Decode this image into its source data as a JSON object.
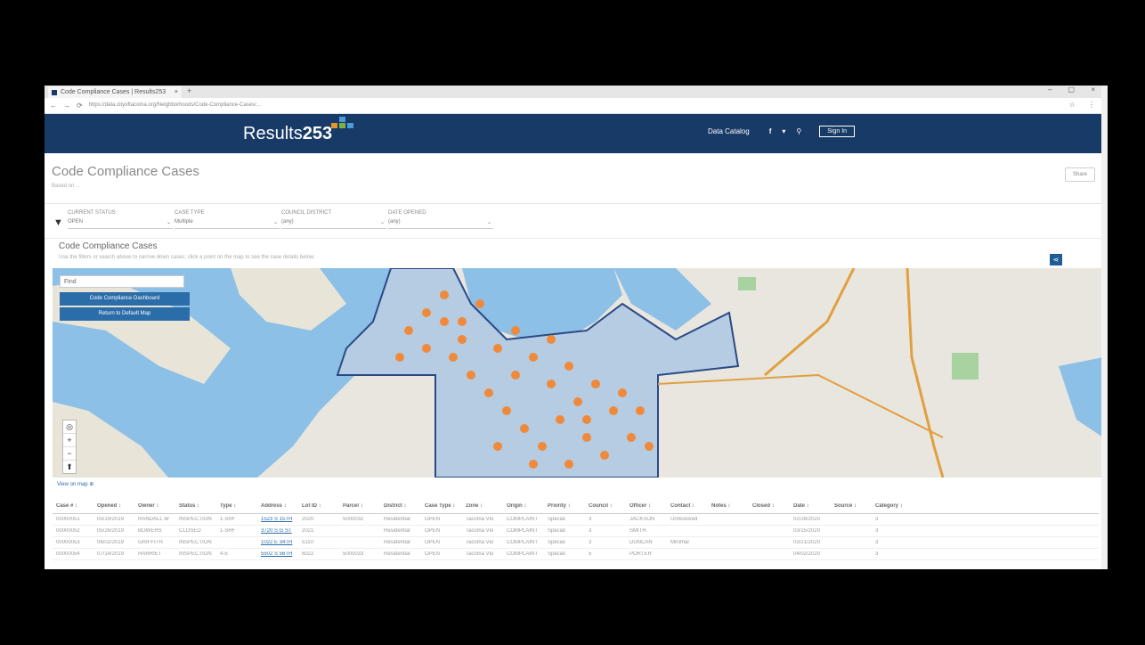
{
  "browser": {
    "tab_title": "Code Compliance Cases | Results253",
    "tab_close": "×",
    "new_tab": "+",
    "window_controls": "– ▢ ×",
    "nav_back": "←",
    "nav_forward": "→",
    "nav_reload": "⟳",
    "url": "https://data.cityoftacoma.org/Neighborhoods/Code-Compliance-Cases/...",
    "toolbar_right": "☆ ⋮"
  },
  "navbar": {
    "logo_text": "Results",
    "logo_number": "253",
    "data_catalog": "Data Catalog",
    "facebook_icon": "f",
    "twitter_icon": "▾",
    "search_icon": "⚲",
    "sign_in": "Sign In"
  },
  "page": {
    "title": "Code Compliance Cases",
    "subtitle": "Based on ...",
    "share_label": "Share"
  },
  "filters": [
    {
      "label": "CURRENT STATUS",
      "value": "OPEN"
    },
    {
      "label": "CASE TYPE",
      "value": "Multiple"
    },
    {
      "label": "COUNCIL DISTRICT",
      "value": "(any)"
    },
    {
      "label": "DATE OPENED",
      "value": "(any)"
    }
  ],
  "section": {
    "title": "Code Compliance Cases",
    "description": "Use the filters or search above to narrow down cases; click a point on the map to see the case details below."
  },
  "map": {
    "search_placeholder": "Find",
    "btn_report": "Code Compliance Dashboard",
    "btn_return": "Return to Default Map",
    "link_text": "View on map ⊕",
    "colors": {
      "water": "#8cc0e6",
      "city_fill": "#b5cce3",
      "boundary": "#2a4a86",
      "points": "#f08a3a"
    }
  },
  "table": {
    "headers": [
      "Case #",
      "Opened",
      "Owner",
      "Status",
      "Type",
      "Address",
      "Lot ID",
      "Parcel",
      "District",
      "Case Type",
      "Zone",
      "Origin",
      "Priority",
      "Council",
      "Officer",
      "Contact",
      "Notes",
      "Closed",
      "Date",
      "Source",
      "Category"
    ],
    "rows": [
      [
        "00000051",
        "05/19/2019",
        "RANDALL W",
        "INSPECTION",
        "1-SRF",
        "1523 S 15TH",
        "2020",
        "5000032",
        "Residential",
        "OPEN",
        "Tacoma Vio",
        "COMPLAINT",
        "Special",
        "3",
        "JACKSON",
        "Unresolved",
        "",
        "",
        "02/28/2020",
        "",
        "3"
      ],
      [
        "00000052",
        "05/26/2019",
        "BOWERS",
        "CLOSED",
        "1-SRF",
        "3720 S G ST",
        "2021",
        "",
        "Residential",
        "OPEN",
        "Tacoma Vio",
        "COMPLAINT",
        "Special",
        "3",
        "SMITH",
        "",
        "",
        "",
        "03/15/2020",
        "",
        "3"
      ],
      [
        "00000053",
        "06/02/2019",
        "GRIFFITH",
        "INSPECTION",
        "",
        "1022 E 34TH",
        "5110",
        "",
        "Residential",
        "OPEN",
        "Tacoma Vio",
        "COMPLAINT",
        "Special",
        "3",
        "DUNCAN",
        "Minimal",
        "",
        "",
        "03/21/2020",
        "",
        "3"
      ],
      [
        "00000054",
        "07/14/2019",
        "HARRIET",
        "INSPECTION",
        "4-E",
        "5502 S 56TH",
        "6022",
        "5000033",
        "Residential",
        "OPEN",
        "Tacoma Vio",
        "COMPLAINT",
        "Special",
        "5",
        "PORTER",
        "",
        "",
        "",
        "04/02/2020",
        "",
        "3"
      ]
    ]
  }
}
